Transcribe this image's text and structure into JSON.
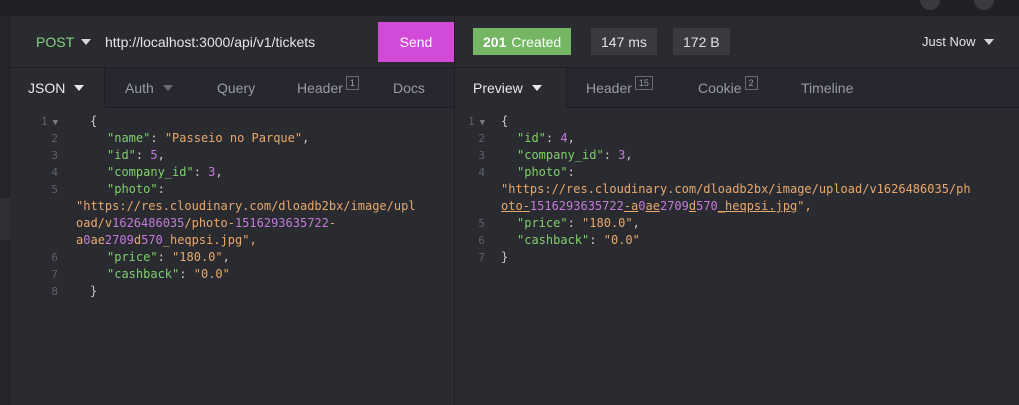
{
  "request": {
    "method": "POST",
    "url": "http://localhost:3000/api/v1/tickets",
    "send_label": "Send",
    "tabs": [
      {
        "label": "JSON",
        "badge": ""
      },
      {
        "label": "Auth",
        "badge": ""
      },
      {
        "label": "Query",
        "badge": ""
      },
      {
        "label": "Header",
        "badge": "1"
      },
      {
        "label": "Docs",
        "badge": ""
      }
    ],
    "body_lines": [
      "{",
      "\"name\": \"Passeio no Parque\",",
      "\"id\": 5,",
      "\"company_id\": 3,",
      "\"photo\":",
      "\"https://res.cloudinary.com/dloadb2bx/image/upl",
      "oad/v1626486035/photo-1516293635722-",
      "a0ae2709d570_heqpsi.jpg\",",
      "\"price\": \"180.0\",",
      "\"cashback\": \"0.0\"",
      "}"
    ],
    "line_numbers": [
      "1",
      "2",
      "3",
      "4",
      "5",
      "6",
      "7",
      "8"
    ]
  },
  "response": {
    "status_code": "201",
    "status_text": "Created",
    "time": "147 ms",
    "size": "172 B",
    "history": "Just Now",
    "tabs": [
      {
        "label": "Preview",
        "badge": ""
      },
      {
        "label": "Header",
        "badge": "15"
      },
      {
        "label": "Cookie",
        "badge": "2"
      },
      {
        "label": "Timeline",
        "badge": ""
      }
    ],
    "body_lines": [
      "{",
      "\"id\": 4,",
      "\"company_id\": 3,",
      "\"photo\":",
      "\"https://res.cloudinary.com/dloadb2bx/image/upload/v1626486035/ph",
      "oto-1516293635722-a0ae2709d570_heqpsi.jpg\",",
      "\"price\": \"180.0\",",
      "\"cashback\": \"0.0\"",
      "}"
    ],
    "line_numbers": [
      "1",
      "2",
      "3",
      "4",
      "5",
      "6",
      "7"
    ]
  },
  "colors": {
    "send": "#d14ad8",
    "status_ok": "#74b664",
    "method": "#7ed47e",
    "json_key": "#7fcf6b",
    "json_string": "#e8a86a",
    "json_number": "#c27bd8"
  }
}
